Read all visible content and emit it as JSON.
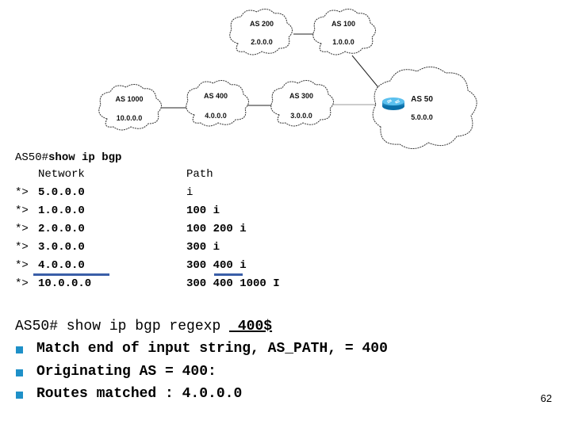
{
  "diagram": {
    "clouds": [
      {
        "id": "as200",
        "as_label": "AS 200",
        "network": "2.0.0.0"
      },
      {
        "id": "as100",
        "as_label": "AS 100",
        "network": "1.0.0.0"
      },
      {
        "id": "as1000",
        "as_label": "AS 1000",
        "network": "10.0.0.0"
      },
      {
        "id": "as400",
        "as_label": "AS 400",
        "network": "4.0.0.0"
      },
      {
        "id": "as300",
        "as_label": "AS 300",
        "network": "3.0.0.0"
      },
      {
        "id": "as50",
        "as_label": "AS 50",
        "network": "5.0.0.0"
      }
    ],
    "links": [
      [
        "as200",
        "as100"
      ],
      [
        "as100",
        "as50"
      ],
      [
        "as1000",
        "as400"
      ],
      [
        "as400",
        "as300"
      ],
      [
        "as300",
        "as50"
      ]
    ],
    "router_icon": "router-icon"
  },
  "bgp_output": {
    "prompt": "AS50#",
    "command": "show ip bgp",
    "headers": {
      "status": "",
      "network": "Network",
      "path": "Path"
    },
    "rows": [
      {
        "status": "*>",
        "network": "5.0.0.0",
        "path": "i"
      },
      {
        "status": "*>",
        "network": "1.0.0.0",
        "path": "100 i"
      },
      {
        "status": "*>",
        "network": "2.0.0.0",
        "path": "100 200 i"
      },
      {
        "status": "*>",
        "network": "3.0.0.0",
        "path": "300 i"
      },
      {
        "status": "*>",
        "network": "4.0.0.0",
        "path": "300 400 i"
      },
      {
        "status": "*>",
        "network": "10.0.0.0",
        "path": "300 400 1000 I"
      }
    ],
    "highlight_color": "#3a5ea8"
  },
  "regexp": {
    "command_prefix": "AS50# show ip bgp regexp ",
    "command_pattern": "_400$",
    "bullets": [
      "Match end of input string, AS_PATH, = 400",
      "Originating AS = 400:",
      "Routes matched : 4.0.0.0"
    ],
    "bullet_color": "#1e90c8"
  },
  "page_number": "62"
}
